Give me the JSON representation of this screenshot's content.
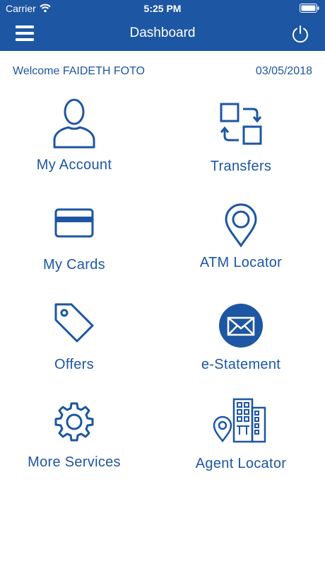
{
  "status_bar": {
    "carrier": "Carrier",
    "time": "5:25 PM"
  },
  "header": {
    "title": "Dashboard",
    "menu_icon": "hamburger-menu-icon",
    "power_icon": "power-icon"
  },
  "welcome_text": "Welcome FAIDETH FOTO",
  "date": "03/05/2018",
  "colors": {
    "primary": "#1d56a3",
    "background": "#ffffff"
  },
  "tiles": [
    {
      "label": "My Account",
      "icon": "user-icon"
    },
    {
      "label": "Transfers",
      "icon": "transfer-arrows-icon"
    },
    {
      "label": "My Cards",
      "icon": "credit-card-icon"
    },
    {
      "label": "ATM Locator",
      "icon": "map-pin-icon"
    },
    {
      "label": "Offers",
      "icon": "price-tag-icon"
    },
    {
      "label": "e-Statement",
      "icon": "envelope-icon"
    },
    {
      "label": "More Services",
      "icon": "gear-icon"
    },
    {
      "label": "Agent Locator",
      "icon": "building-pin-icon"
    }
  ]
}
